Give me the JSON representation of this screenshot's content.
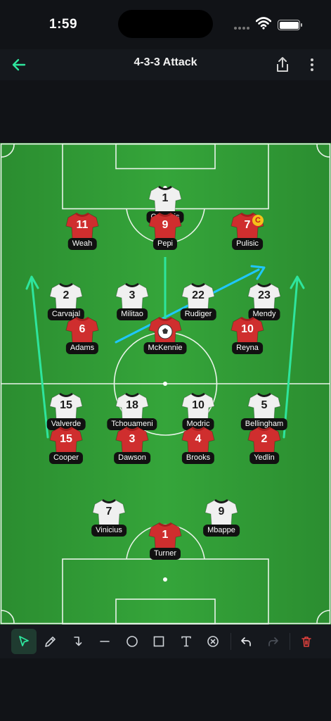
{
  "status": {
    "time": "1:59"
  },
  "nav": {
    "title": "4-3-3 Attack"
  },
  "colors": {
    "accent": "#2ee59d",
    "pitch": "#2f9a34",
    "home_shirt": "#f0f0f0",
    "away_shirt": "#cf2e2e",
    "arrow_blue": "#1fc7ff"
  },
  "players": [
    {
      "num": "1",
      "name": "Courtois",
      "team": "home"
    },
    {
      "num": "11",
      "name": "Weah",
      "team": "away"
    },
    {
      "num": "9",
      "name": "Pepi",
      "team": "away"
    },
    {
      "num": "7",
      "name": "Pulisic",
      "team": "away",
      "captain": "C"
    },
    {
      "num": "2",
      "name": "Carvajal",
      "team": "home"
    },
    {
      "num": "3",
      "name": "Militao",
      "team": "home"
    },
    {
      "num": "22",
      "name": "Rudiger",
      "team": "home"
    },
    {
      "num": "23",
      "name": "Mendy",
      "team": "home"
    },
    {
      "num": "6",
      "name": "Adams",
      "team": "away"
    },
    {
      "num": "",
      "name": "McKennie",
      "team": "away",
      "ball": true
    },
    {
      "num": "10",
      "name": "Reyna",
      "team": "away"
    },
    {
      "num": "15",
      "name": "Valverde",
      "team": "home"
    },
    {
      "num": "18",
      "name": "Tchouameni",
      "team": "home"
    },
    {
      "num": "10",
      "name": "Modric",
      "team": "home"
    },
    {
      "num": "5",
      "name": "Bellingham",
      "team": "home"
    },
    {
      "num": "15",
      "name": "Cooper",
      "team": "away"
    },
    {
      "num": "3",
      "name": "Dawson",
      "team": "away"
    },
    {
      "num": "4",
      "name": "Brooks",
      "team": "away"
    },
    {
      "num": "2",
      "name": "Yedlin",
      "team": "away"
    },
    {
      "num": "7",
      "name": "Vinicius",
      "team": "home"
    },
    {
      "num": "9",
      "name": "Mbappe",
      "team": "home"
    },
    {
      "num": "1",
      "name": "Turner",
      "team": "away"
    }
  ],
  "tools": [
    "select-icon",
    "pen-icon",
    "curved-arrow-icon",
    "line-icon",
    "circle-icon",
    "rectangle-icon",
    "text-icon",
    "clear-icon",
    "undo-icon",
    "redo-icon",
    "trash-icon"
  ]
}
